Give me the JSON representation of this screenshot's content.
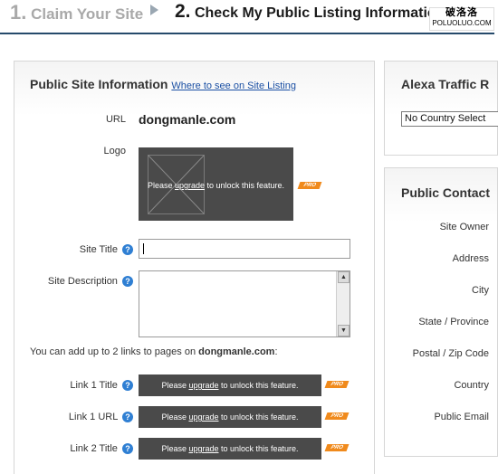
{
  "steps": {
    "step1_num": "1.",
    "step1_label": "Claim Your Site",
    "step2_num": "2.",
    "step2_label": "Check My Public Listing Information"
  },
  "watermark": {
    "line1": "破洛洛",
    "line2": "POLUOLUO.COM"
  },
  "main": {
    "title": "Public Site Information",
    "where_link": "Where to see on Site Listing",
    "url_label": "URL",
    "url_value": "dongmanle.com",
    "logo_label": "Logo",
    "locked_please": "Please ",
    "locked_upgrade": "upgrade",
    "locked_rest": " to unlock this feature.",
    "pro_badge": "PRO",
    "site_title_label": "Site Title",
    "site_title_value": "",
    "site_desc_label": "Site Description",
    "links_note_prefix": "You can add up to 2 links to pages on ",
    "links_note_domain": "dongmanle.com",
    "links_note_suffix": ":",
    "link1_title_label": "Link 1 Title",
    "link1_url_label": "Link 1 URL",
    "link2_title_label": "Link 2 Title",
    "help_glyph": "?"
  },
  "alexa": {
    "title": "Alexa Traffic R",
    "country_select_value": "No Country Select"
  },
  "contact": {
    "title": "Public Contact",
    "labels": [
      "Site Owner",
      "Address",
      "City",
      "State / Province",
      "Postal / Zip Code",
      "Country",
      "Public Email"
    ]
  },
  "colors": {
    "accent_rule": "#264a6b",
    "link": "#1a4fa3",
    "locked_bg": "#4a4a4a",
    "pro_badge": "#f08a1c",
    "help_icon": "#2f7fd3"
  }
}
